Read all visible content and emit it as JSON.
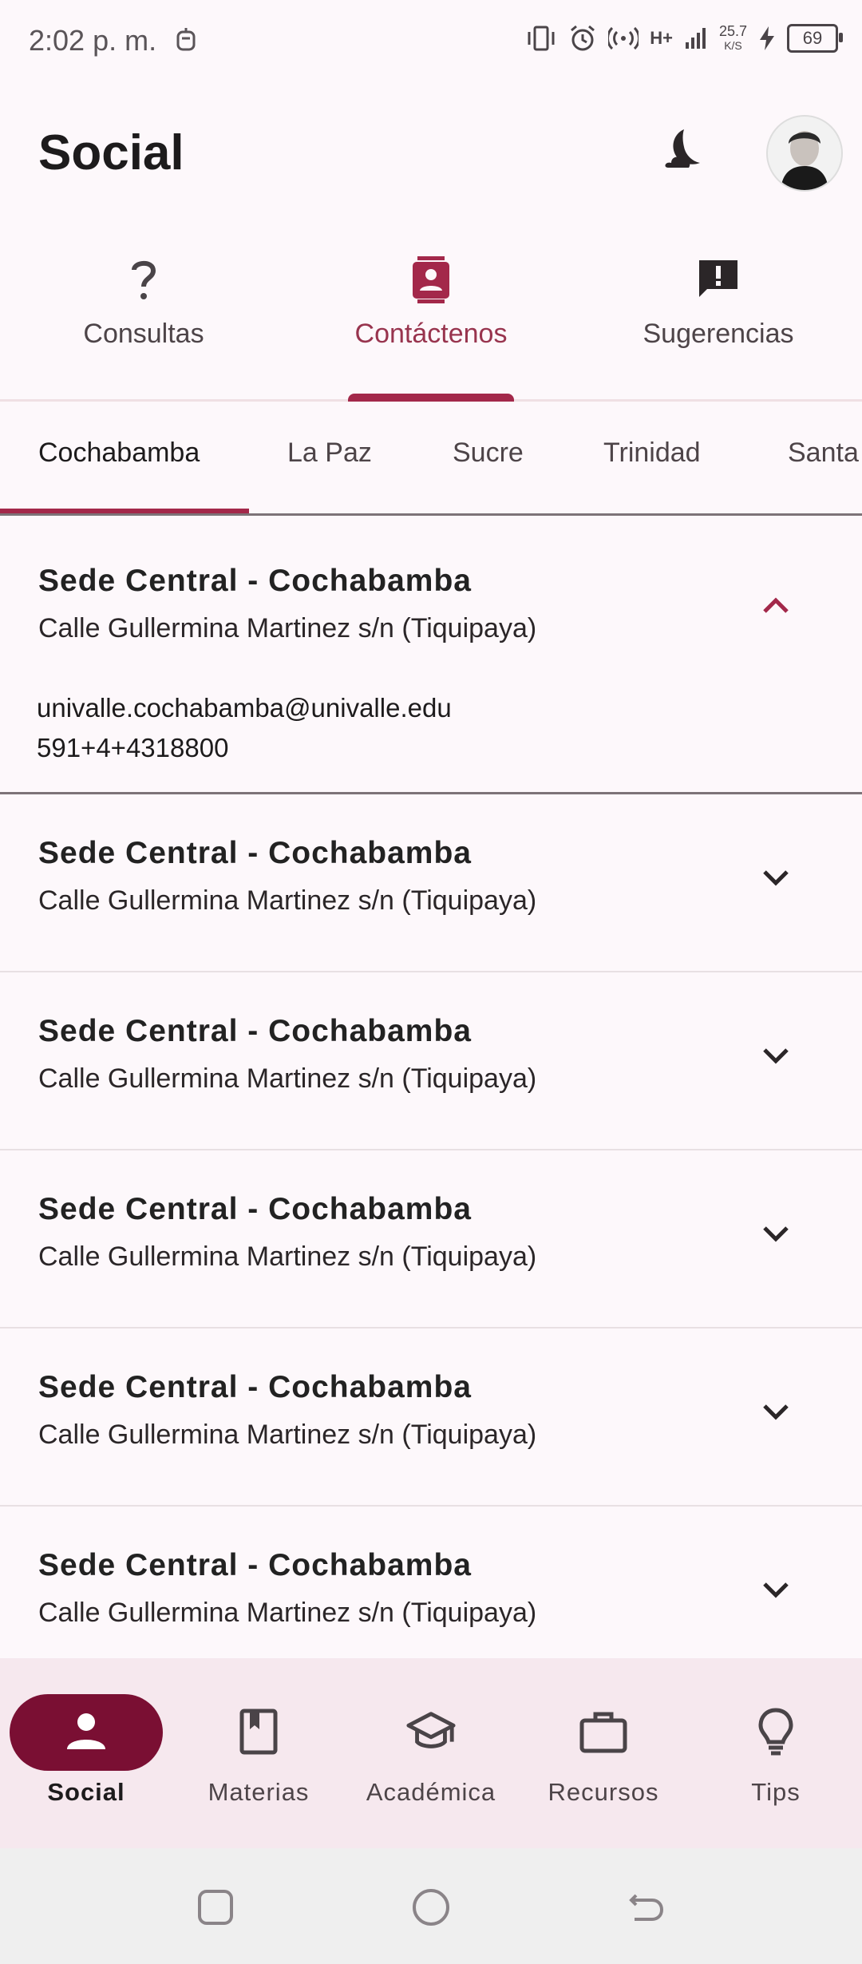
{
  "status_bar": {
    "time": "2:02 p. m.",
    "net_speed_value": "25.7",
    "net_speed_unit": "K/S",
    "network_type": "H+",
    "battery": "69"
  },
  "app_bar": {
    "title": "Social"
  },
  "top_tabs": [
    {
      "label": "Consultas",
      "icon": "question-mark-icon"
    },
    {
      "label": "Contáctenos",
      "icon": "contact-card-icon",
      "active": true
    },
    {
      "label": "Sugerencias",
      "icon": "feedback-icon"
    }
  ],
  "city_tabs": [
    {
      "label": "Cochabamba",
      "active": true
    },
    {
      "label": "La Paz"
    },
    {
      "label": "Sucre"
    },
    {
      "label": "Trinidad"
    },
    {
      "label": "Santa"
    }
  ],
  "locations": [
    {
      "title": "Sede Central - Cochabamba",
      "address": "Calle Gullermina Martinez s/n (Tiquipaya)",
      "email": "univalle.cochabamba@univalle.edu",
      "phone": "591+4+4318800",
      "expanded": true
    },
    {
      "title": "Sede Central - Cochabamba",
      "address": "Calle Gullermina Martinez s/n (Tiquipaya)"
    },
    {
      "title": "Sede Central - Cochabamba",
      "address": "Calle Gullermina Martinez s/n (Tiquipaya)"
    },
    {
      "title": "Sede Central - Cochabamba",
      "address": "Calle Gullermina Martinez s/n (Tiquipaya)"
    },
    {
      "title": "Sede Central - Cochabamba",
      "address": "Calle Gullermina Martinez s/n (Tiquipaya)"
    },
    {
      "title": "Sede Central - Cochabamba",
      "address": "Calle Gullermina Martinez s/n (Tiquipaya)"
    }
  ],
  "bottom_nav": [
    {
      "label": "Social",
      "icon": "person-icon",
      "active": true
    },
    {
      "label": "Materias",
      "icon": "book-icon"
    },
    {
      "label": "Académica",
      "icon": "graduation-cap-icon"
    },
    {
      "label": "Recursos",
      "icon": "briefcase-icon"
    },
    {
      "label": "Tips",
      "icon": "lightbulb-icon"
    }
  ],
  "colors": {
    "accent": "#a3284a",
    "nav_pill": "#7a0f33",
    "nav_background": "#f6e8ee"
  }
}
